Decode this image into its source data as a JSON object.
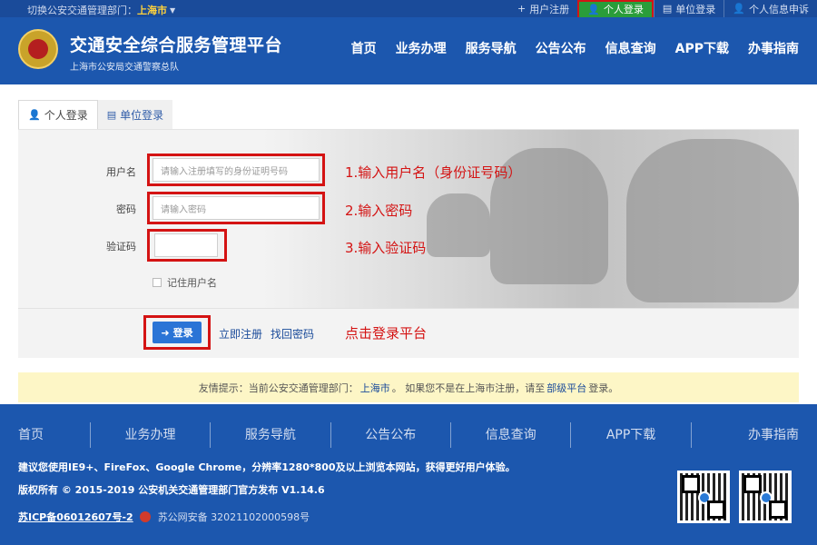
{
  "topbar": {
    "switch_label": "切换公安交通管理部门：",
    "city": "上海市",
    "links": [
      {
        "icon": "plus-icon",
        "glyph": "+",
        "label": "用户注册"
      },
      {
        "icon": "person-icon",
        "glyph": "👤",
        "label": "个人登录",
        "active": true
      },
      {
        "icon": "building-icon",
        "glyph": "▤",
        "label": "单位登录"
      },
      {
        "icon": "person-icon",
        "glyph": "👤",
        "label": "个人信息申诉"
      }
    ]
  },
  "header": {
    "title": "交通安全综合服务管理平台",
    "subtitle": "上海市公安局交通警察总队",
    "nav": [
      "首页",
      "业务办理",
      "服务导航",
      "公告公布",
      "信息查询",
      "APP下载",
      "办事指南"
    ]
  },
  "tabs": [
    {
      "label": "个人登录",
      "active": true
    },
    {
      "label": "单位登录",
      "active": false
    }
  ],
  "form": {
    "username_label": "用户名",
    "username_placeholder": "请输入注册填写的身份证明号码",
    "password_label": "密码",
    "password_placeholder": "请输入密码",
    "captcha_label": "验证码",
    "captcha_value": "",
    "remember_label": "记住用户名",
    "login_button": "登录",
    "register_link": "立即注册",
    "forgot_link": "找回密码"
  },
  "annotations": {
    "step1": "1.输入用户名（身份证号码）",
    "step2": "2.输入密码",
    "step3": "3.输入验证码",
    "step4": "点击登录平台"
  },
  "hint": {
    "prefix": "友情提示：当前公安交通管理部门：",
    "city": "上海市",
    "middle": "。 如果您不是在上海市注册，请至",
    "link": "部级平台",
    "suffix": "登录。"
  },
  "footer": {
    "nav": [
      "首页",
      "业务办理",
      "服务导航",
      "公告公布",
      "信息查询",
      "APP下载",
      "办事指南"
    ],
    "browser_note": "建议您使用IE9+、FireFox、Google Chrome，分辨率1280*800及以上浏览本网站，获得更好用户体验。",
    "copyright": "版权所有 © 2015-2019 公安机关交通管理部门官方发布 V1.14.6",
    "icp": "苏ICP备06012607号-2",
    "police_record": "苏公网安备 32021102000598号"
  },
  "colors": {
    "brand_blue": "#1c57ae",
    "active_green": "#2a9d3a",
    "annotation_red": "#d41313",
    "hint_bg": "#fdf6c6"
  }
}
